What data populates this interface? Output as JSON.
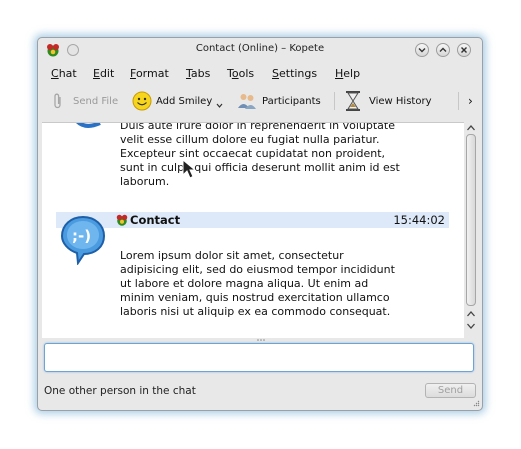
{
  "window": {
    "title": "Contact (Online) – Kopete"
  },
  "menu": {
    "items": [
      {
        "accel": "C",
        "rest": "hat"
      },
      {
        "accel": "E",
        "rest": "dit"
      },
      {
        "accel": "F",
        "rest": "ormat"
      },
      {
        "accel": "T",
        "rest": "abs"
      },
      {
        "pre": "T",
        "accel": "o",
        "rest": "ols"
      },
      {
        "accel": "S",
        "rest": "ettings"
      },
      {
        "accel": "H",
        "rest": "elp"
      }
    ]
  },
  "toolbar": {
    "send_file": "Send File",
    "add_smiley": "Add Smiley",
    "participants": "Participants",
    "view_history": "View History",
    "overflow": "›"
  },
  "chat": {
    "previous_lines": [
      "Duis aute irure dolor in reprehenderit in voluptate",
      "velit esse cillum dolore eu fugiat nulla pariatur.",
      "Excepteur sint occaecat cupidatat non proident,",
      "sunt in culpa qui officia deserunt mollit anim id est",
      "laborum."
    ],
    "message": {
      "sender": "Contact",
      "time": "15:44:02",
      "lines": [
        "Lorem ipsum dolor sit amet, consectetur",
        "adipisicing elit, sed do eiusmod tempor incididunt",
        "ut labore et dolore magna aliqua. Ut enim ad",
        "minim veniam, quis nostrud exercitation ullamco",
        "laboris nisi ut aliquip ex ea commodo consequat."
      ]
    }
  },
  "input": {
    "value": ""
  },
  "statusbar": {
    "text": "One other person in the chat",
    "send_label": "Send"
  },
  "colors": {
    "header_bg": "#dde9f8",
    "input_border": "#6fa3d2",
    "glow": "#6eaad2"
  }
}
